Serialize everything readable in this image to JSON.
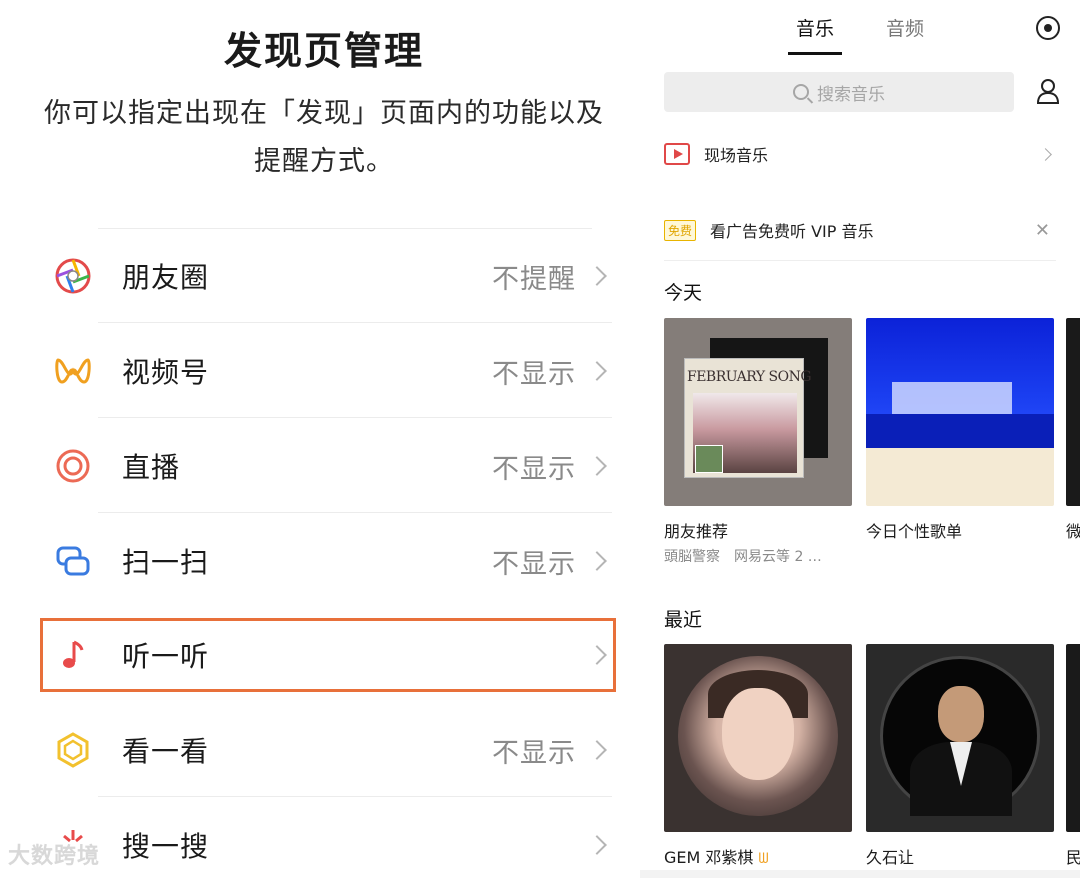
{
  "left": {
    "title": "发现页管理",
    "description": "你可以指定出现在「发现」页面内的功能以及提醒方式。",
    "rows": [
      {
        "label": "朋友圈",
        "status": "不提醒",
        "icon": "moments-icon"
      },
      {
        "label": "视频号",
        "status": "不显示",
        "icon": "channels-icon"
      },
      {
        "label": "直播",
        "status": "不显示",
        "icon": "live-icon"
      },
      {
        "label": "扫一扫",
        "status": "不显示",
        "icon": "scan-icon"
      },
      {
        "label": "听一听",
        "status": "",
        "icon": "music-note-icon"
      },
      {
        "label": "看一看",
        "status": "不显示",
        "icon": "top-stories-icon"
      },
      {
        "label": "搜一搜",
        "status": "",
        "icon": "search-icon"
      }
    ],
    "watermark": "大数跨境"
  },
  "right": {
    "tabs": [
      "音乐",
      "音频"
    ],
    "search_placeholder": "搜索音乐",
    "live_music": "现场音乐",
    "ad_badge": "免费",
    "ad_text": "看广告免费听 VIP 音乐",
    "today_title": "今天",
    "recent_title": "最近",
    "today_cards": [
      {
        "title": "朋友推荐",
        "subtitle": "頭脳警察　网易云等 2 …",
        "cover_text": "FEBRUARY SONG"
      },
      {
        "title": "今日个性歌单",
        "subtitle": ""
      },
      {
        "title": "微",
        "subtitle": ""
      }
    ],
    "recent_cards": [
      {
        "title": "GEM 邓紫棋"
      },
      {
        "title": "久石让"
      },
      {
        "title": "民"
      }
    ],
    "colors": {
      "selected_border": "#e8703a",
      "live_red": "#e04848",
      "ad_yellow": "#e8b400"
    }
  }
}
